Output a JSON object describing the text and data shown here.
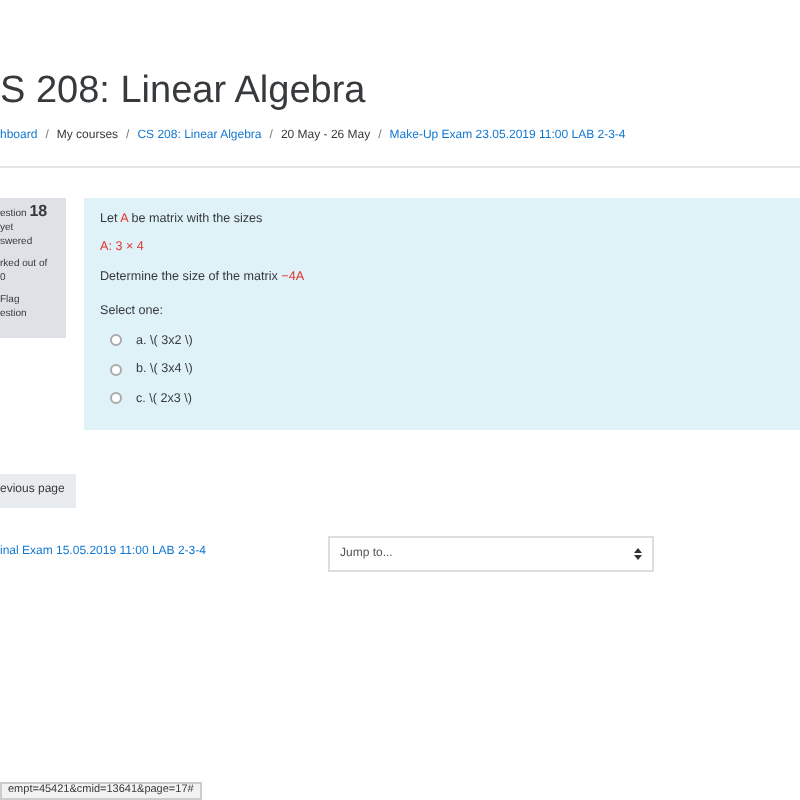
{
  "heading": "S 208: Linear Algebra",
  "breadcrumb": [
    {
      "text": "hboard",
      "link": true
    },
    {
      "sep": "/",
      "text": "My courses",
      "link": false
    },
    {
      "sep": "/",
      "text": "CS 208: Linear Algebra",
      "link": true
    },
    {
      "sep": "/",
      "text": "20 May - 26 May",
      "link": false
    },
    {
      "sep": "/",
      "text": "Make-Up Exam 23.05.2019 11:00 LAB 2-3-4",
      "link": true
    }
  ],
  "info": {
    "question_label": "estion",
    "number": "18",
    "status": [
      "yet",
      "swered"
    ],
    "marks": [
      "rked out of",
      "0"
    ],
    "flag": [
      "Flag",
      "estion"
    ]
  },
  "question": {
    "lines": [
      [
        {
          "text": "Let ",
          "red": false
        },
        {
          "text": "A",
          "red": true
        },
        {
          "text": " be matrix with the sizes",
          "red": false
        }
      ],
      [
        {
          "text": "A: 3 × 4",
          "red": true
        }
      ],
      [
        {
          "text": "Determine the size of the matrix ",
          "red": false
        },
        {
          "text": "−4A",
          "red": true
        }
      ]
    ],
    "prompt": "Select one:",
    "options": [
      {
        "label": "a. \\( 3x2 \\)",
        "checked": false
      },
      {
        "label": "b. \\( 3x4 \\)",
        "checked": false
      },
      {
        "label": "c. \\( 2x3 \\)",
        "checked": false
      }
    ]
  },
  "prev_button": "evious page",
  "prev_link": "inal Exam 15.05.2019 11:00 LAB 2-3-4",
  "jump": {
    "placeholder": "Jump to..."
  },
  "status_url": "empt=45421&cmid=13641&page=17#"
}
